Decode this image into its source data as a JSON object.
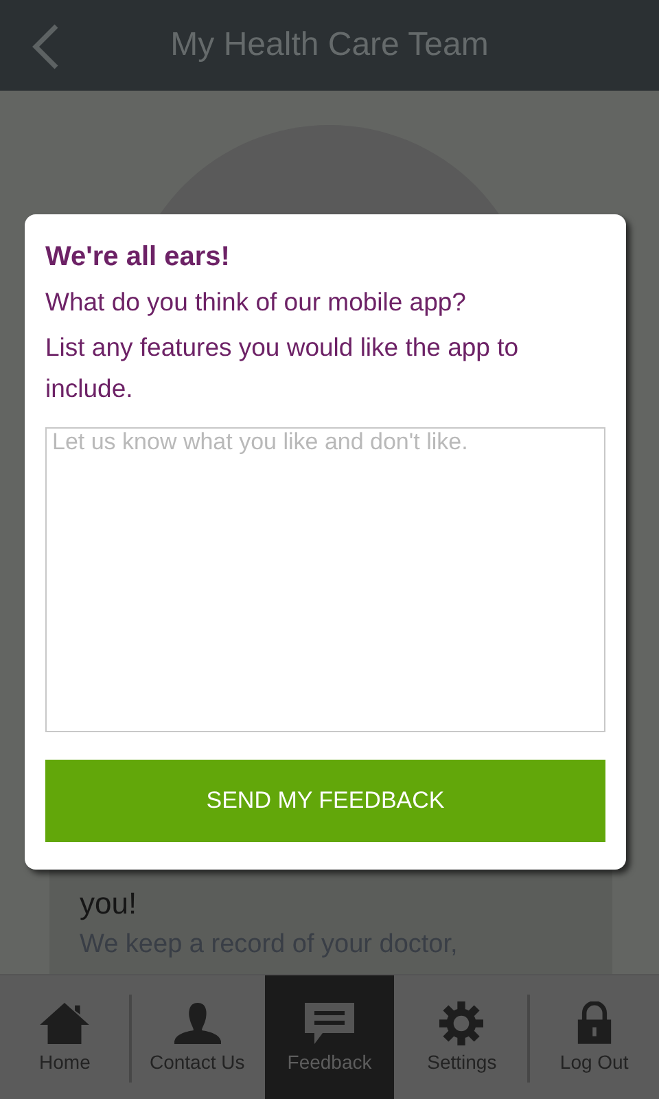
{
  "header": {
    "title": "My Health Care Team"
  },
  "background_card": {
    "heading": "you!",
    "text": "We keep a record of your doctor,"
  },
  "dialog": {
    "title": "We're all ears!",
    "question": "What do you think of our mobile app?",
    "prompt": "List any features you would like the app to include.",
    "feedback_field": {
      "placeholder": "Let us know what you like and don't like."
    },
    "submit_button": "SEND MY FEEDBACK"
  },
  "nav": [
    {
      "label": "Home",
      "kind": "home",
      "selected": false
    },
    {
      "label": "Contact Us",
      "kind": "person",
      "selected": false
    },
    {
      "label": "Feedback",
      "kind": "chat",
      "selected": true
    },
    {
      "label": "Settings",
      "kind": "gear",
      "selected": false
    },
    {
      "label": "Log Out",
      "kind": "lock",
      "selected": false
    }
  ]
}
